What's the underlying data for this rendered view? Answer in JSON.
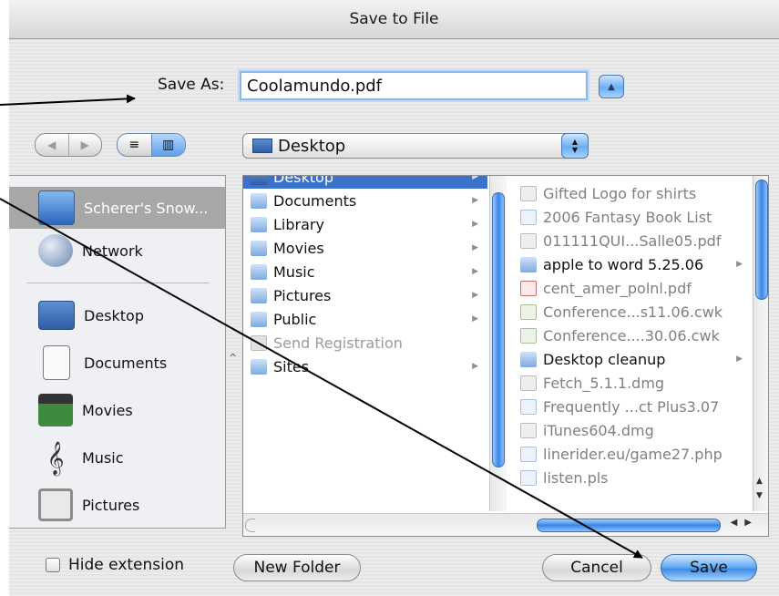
{
  "window": {
    "title": "Save to File"
  },
  "save_as": {
    "label": "Save As:",
    "value": "Coolamundo.pdf"
  },
  "toolbar": {
    "back_glyph": "◀",
    "forward_glyph": "▶",
    "list_view_glyph": "≡",
    "column_view_glyph": "▥",
    "location": "Desktop",
    "location_options": [
      "Desktop"
    ]
  },
  "sidebar": {
    "items": [
      {
        "label": "Scherer's Snow...",
        "icon": "hard-drive-icon",
        "selected": true
      },
      {
        "label": "Network",
        "icon": "network-globe-icon"
      },
      {
        "label": "Desktop",
        "icon": "desktop-folder-icon"
      },
      {
        "label": "Documents",
        "icon": "documents-icon"
      },
      {
        "label": "Movies",
        "icon": "clapperboard-icon"
      },
      {
        "label": "Music",
        "icon": "treble-clef-icon"
      },
      {
        "label": "Pictures",
        "icon": "picture-frame-icon"
      }
    ]
  },
  "browser": {
    "column1": [
      {
        "label": "Desktop",
        "selected": true,
        "arrow": true
      },
      {
        "label": "Documents",
        "arrow": true
      },
      {
        "label": "Library",
        "arrow": true
      },
      {
        "label": "Movies",
        "arrow": true
      },
      {
        "label": "Music",
        "arrow": true
      },
      {
        "label": "Pictures",
        "arrow": true
      },
      {
        "label": "Public",
        "arrow": true
      },
      {
        "label": "Send Registration",
        "dim": true
      },
      {
        "label": "Sites",
        "arrow": true
      }
    ],
    "column2": [
      {
        "label": "Gifted Logo for shirts"
      },
      {
        "label": "2006 Fantasy Book List"
      },
      {
        "label": "011111QUI...Salle05.pdf"
      },
      {
        "label": "apple to word 5.25.06",
        "folder": true,
        "arrow": true
      },
      {
        "label": "cent_amer_polnl.pdf"
      },
      {
        "label": "Conference...s11.06.cwk"
      },
      {
        "label": "Conference....30.06.cwk"
      },
      {
        "label": "Desktop cleanup",
        "folder": true,
        "arrow": true
      },
      {
        "label": "Fetch_5.1.1.dmg"
      },
      {
        "label": "Frequently ...ct Plus3.07"
      },
      {
        "label": "iTunes604.dmg"
      },
      {
        "label": "linerider.eu/game27.php"
      },
      {
        "label": "listen.pls"
      }
    ]
  },
  "footer": {
    "hide_extension_label": "Hide extension",
    "hide_extension_checked": false,
    "new_folder_label": "New Folder",
    "cancel_label": "Cancel",
    "save_label": "Save"
  },
  "colors": {
    "accent": "#3a86e5",
    "selection": "#3a72cc",
    "sidebar_selection": "#a7a7a7"
  }
}
